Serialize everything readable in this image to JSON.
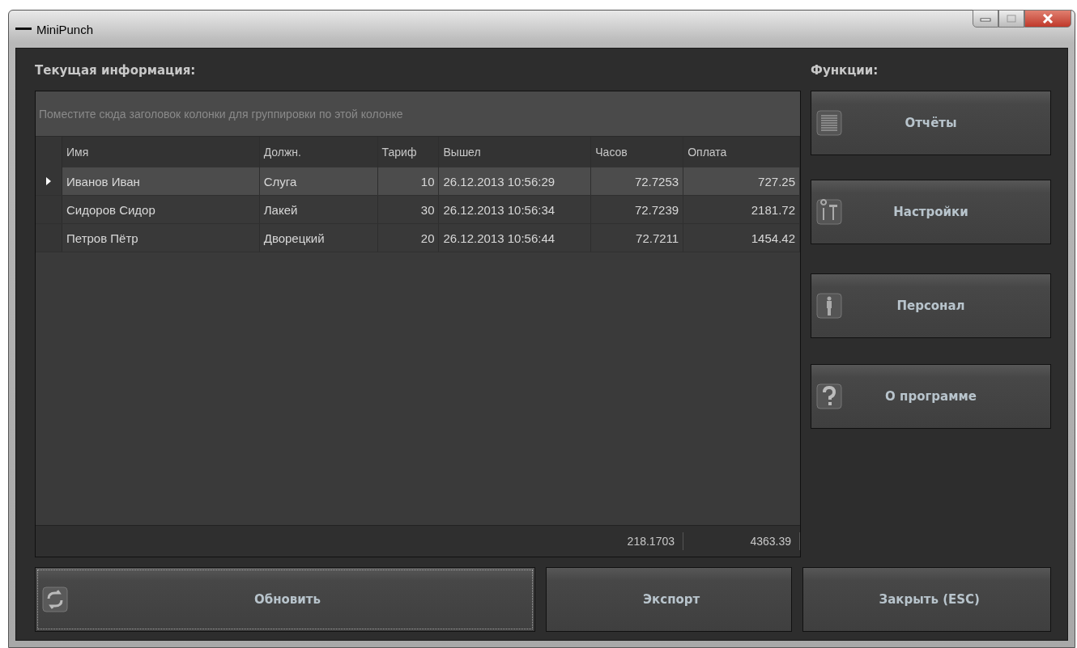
{
  "window": {
    "title": "MiniPunch"
  },
  "left_panel": {
    "heading": "Текущая информация:"
  },
  "table": {
    "group_panel": {
      "placeholder": "Поместите сюда заголовок колонки для группировки по этой колонке"
    },
    "columns": [
      {
        "label": "Имя",
        "kind": "text"
      },
      {
        "label": "Должн.",
        "kind": "text"
      },
      {
        "label": "Тариф",
        "kind": "number"
      },
      {
        "label": "Вышел",
        "kind": "text"
      },
      {
        "label": "Часов",
        "kind": "number"
      },
      {
        "label": "Оплата",
        "kind": "number"
      }
    ],
    "rows": [
      {
        "selected": true,
        "cells": [
          "Иванов Иван",
          "Слуга",
          "10",
          "26.12.2013 10:56:29",
          "72.7253",
          "727.25"
        ]
      },
      {
        "selected": false,
        "cells": [
          "Сидоров Сидор",
          "Лакей",
          "30",
          "26.12.2013 10:56:34",
          "72.7239",
          "2181.72"
        ]
      },
      {
        "selected": false,
        "cells": [
          "Петров Пётр",
          "Дворецкий",
          "20",
          "26.12.2013 10:56:44",
          "72.7211",
          "1454.42"
        ]
      }
    ],
    "totals": {
      "hours": "218.1703",
      "pay": "4363.39"
    }
  },
  "right_panel": {
    "heading": "Функции:",
    "buttons": [
      {
        "label": "Отчёты",
        "kind": "list"
      },
      {
        "label": "Настройки",
        "kind": "tools"
      },
      {
        "label": "Персонал",
        "kind": "person"
      },
      {
        "label": "О программе",
        "kind": "help"
      }
    ]
  },
  "bottom_buttons": [
    {
      "label": "Обновить",
      "kind": "refresh",
      "focused": true
    },
    {
      "label": "Экспорт",
      "kind": "plain",
      "focused": false
    },
    {
      "label": "Закрыть (ESC)",
      "kind": "plain",
      "focused": false
    }
  ]
}
